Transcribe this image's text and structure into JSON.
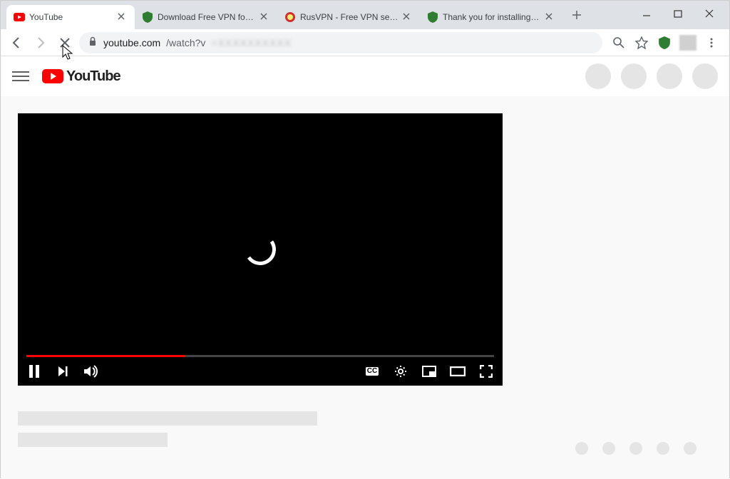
{
  "browser": {
    "tabs": [
      {
        "title": "YouTube",
        "favicon": "youtube"
      },
      {
        "title": "Download Free VPN for Go",
        "favicon": "shield"
      },
      {
        "title": "RusVPN - Free VPN servic",
        "favicon": "rusvpn"
      },
      {
        "title": "Thank you for installing ou",
        "favicon": "shield"
      }
    ],
    "url_host": "youtube.com",
    "url_path": "/watch?v"
  },
  "page": {
    "logo_text": "YouTube",
    "player": {
      "progress_pct": 34,
      "cc_label": "CC"
    }
  }
}
